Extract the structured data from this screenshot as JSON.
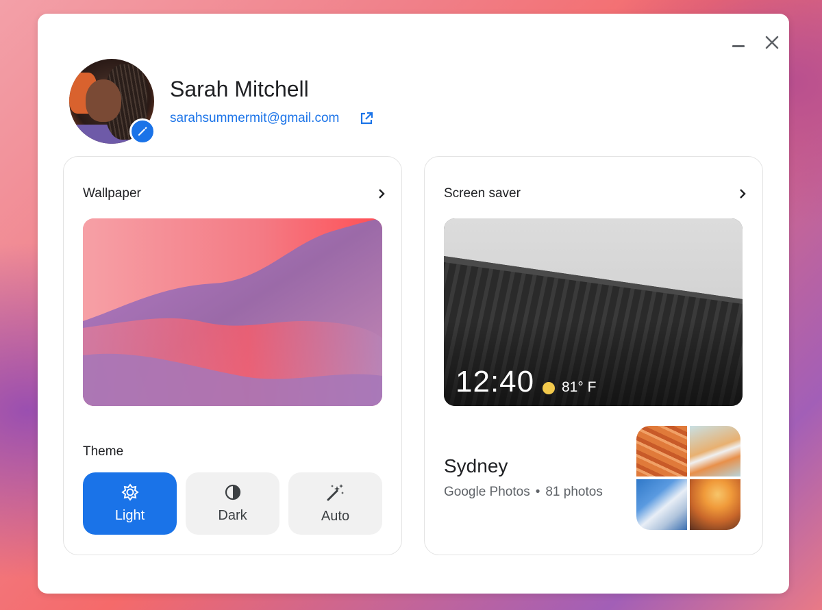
{
  "user": {
    "name": "Sarah Mitchell",
    "email": "sarahsummermit@gmail.com"
  },
  "wallpaper": {
    "title": "Wallpaper"
  },
  "theme": {
    "label": "Theme",
    "options": [
      {
        "label": "Light",
        "icon": "brightness-icon",
        "selected": true
      },
      {
        "label": "Dark",
        "icon": "contrast-icon",
        "selected": false
      },
      {
        "label": "Auto",
        "icon": "magic-wand-icon",
        "selected": false
      }
    ]
  },
  "screensaver": {
    "title": "Screen saver",
    "clock": "12:40",
    "temperature": "81° F",
    "album": {
      "name": "Sydney",
      "source": "Google Photos",
      "count": "81 photos"
    }
  },
  "colors": {
    "accent": "#1a73e8",
    "text": "#202124",
    "secondary_text": "#5f6368",
    "weather_sun": "#f2c94c"
  }
}
